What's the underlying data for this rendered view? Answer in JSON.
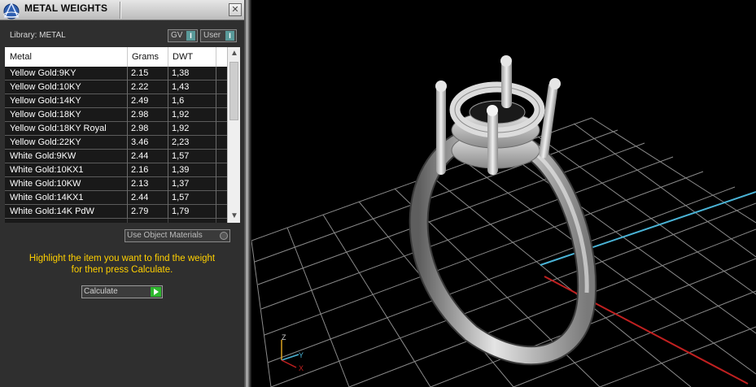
{
  "window": {
    "title": "METAL WEIGHTS",
    "close_glyph": "✕"
  },
  "library": {
    "label": "Library: METAL"
  },
  "toggles": {
    "gv": "GV",
    "user": "User",
    "indicator": "I"
  },
  "table": {
    "columns": [
      "Metal",
      "Grams",
      "DWT"
    ],
    "rows": [
      {
        "metal": "Yellow Gold:9KY",
        "grams": "2.15",
        "dwt": "1,38"
      },
      {
        "metal": "Yellow Gold:10KY",
        "grams": "2.22",
        "dwt": "1,43"
      },
      {
        "metal": "Yellow Gold:14KY",
        "grams": "2.49",
        "dwt": "1,6"
      },
      {
        "metal": "Yellow Gold:18KY",
        "grams": "2.98",
        "dwt": "1,92"
      },
      {
        "metal": "Yellow Gold:18KY Royal",
        "grams": "2.98",
        "dwt": "1,92"
      },
      {
        "metal": "Yellow Gold:22KY",
        "grams": "3.46",
        "dwt": "2,23"
      },
      {
        "metal": "White Gold:9KW",
        "grams": "2.44",
        "dwt": "1,57"
      },
      {
        "metal": "White Gold:10KX1",
        "grams": "2.16",
        "dwt": "1,39"
      },
      {
        "metal": "White Gold:10KW",
        "grams": "2.13",
        "dwt": "1,37"
      },
      {
        "metal": "White Gold:14KX1",
        "grams": "2.44",
        "dwt": "1,57"
      },
      {
        "metal": "White Gold:14K PdW",
        "grams": "2.79",
        "dwt": "1,79"
      }
    ]
  },
  "options": {
    "use_object_materials": "Use Object Materials"
  },
  "instructions": {
    "line1": "Highlight the item you want to find the weight",
    "line2": "for then press Calculate."
  },
  "calculate_button": "Calculate",
  "viewport": {
    "axis_labels": {
      "z": "Z",
      "y": "Y",
      "x": "X"
    },
    "colors": {
      "y_axis": "#4ab3d6",
      "x_axis": "#c02020",
      "grid": "#8a8a8a",
      "model": "#c8c8c8"
    }
  },
  "colors": {
    "instruction_text": "#ffd000",
    "panel_bg": "#2f2f2f"
  }
}
